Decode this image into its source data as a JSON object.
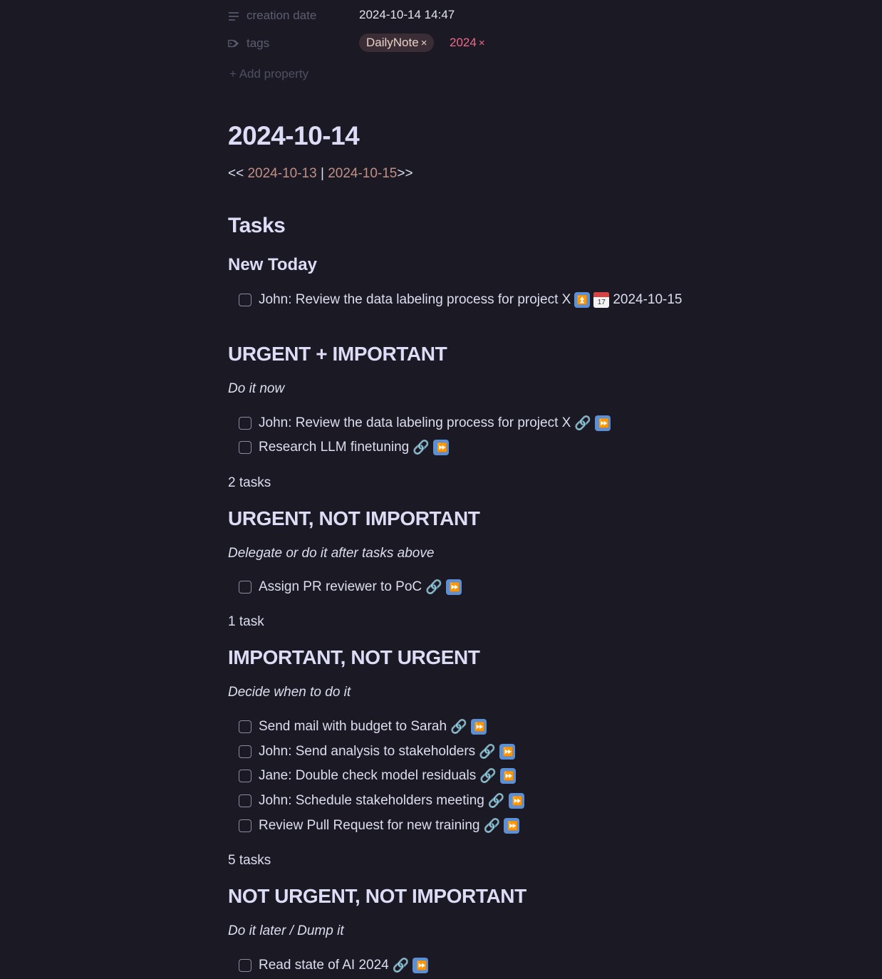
{
  "properties": {
    "creation_label": "creation date",
    "creation_value": "2024-10-14 14:47",
    "tags_label": "tags",
    "tags": [
      "DailyNote",
      "2024"
    ],
    "tag_remove": "×",
    "add_property": "+ Add property"
  },
  "note": {
    "title": "2024-10-14",
    "nav": {
      "prefix": "<< ",
      "prev": "2024-10-13",
      "sep": " | ",
      "next": "2024-10-15",
      "suffix": ">>"
    },
    "tasks_heading": "Tasks",
    "new_today_heading": "New Today"
  },
  "icons": {
    "link": "🔗",
    "forward": "⏩",
    "priority": "⏫",
    "calendar": "📅",
    "calendar_day": "17"
  },
  "new_today": {
    "task": "John: Review the data labeling process for project X",
    "due": "2024-10-15"
  },
  "sections": [
    {
      "title": "URGENT + IMPORTANT",
      "subtitle": "Do it now",
      "tasks": [
        "John: Review the data labeling process for project X",
        "Research LLM finetuning"
      ],
      "count": "2 tasks"
    },
    {
      "title": "URGENT, NOT IMPORTANT",
      "subtitle": "Delegate or do it after tasks above",
      "tasks": [
        "Assign PR reviewer to PoC"
      ],
      "count": "1 task"
    },
    {
      "title": "IMPORTANT, NOT URGENT",
      "subtitle": "Decide when to do it",
      "tasks": [
        "Send mail with budget to Sarah",
        "John: Send analysis to stakeholders",
        "Jane: Double check model residuals",
        "John: Schedule stakeholders meeting",
        "Review Pull Request for new training"
      ],
      "count": "5 tasks"
    },
    {
      "title": "NOT URGENT, NOT IMPORTANT",
      "subtitle": "Do it later / Dump it",
      "tasks": [
        "Read state of AI 2024"
      ]
    }
  ]
}
